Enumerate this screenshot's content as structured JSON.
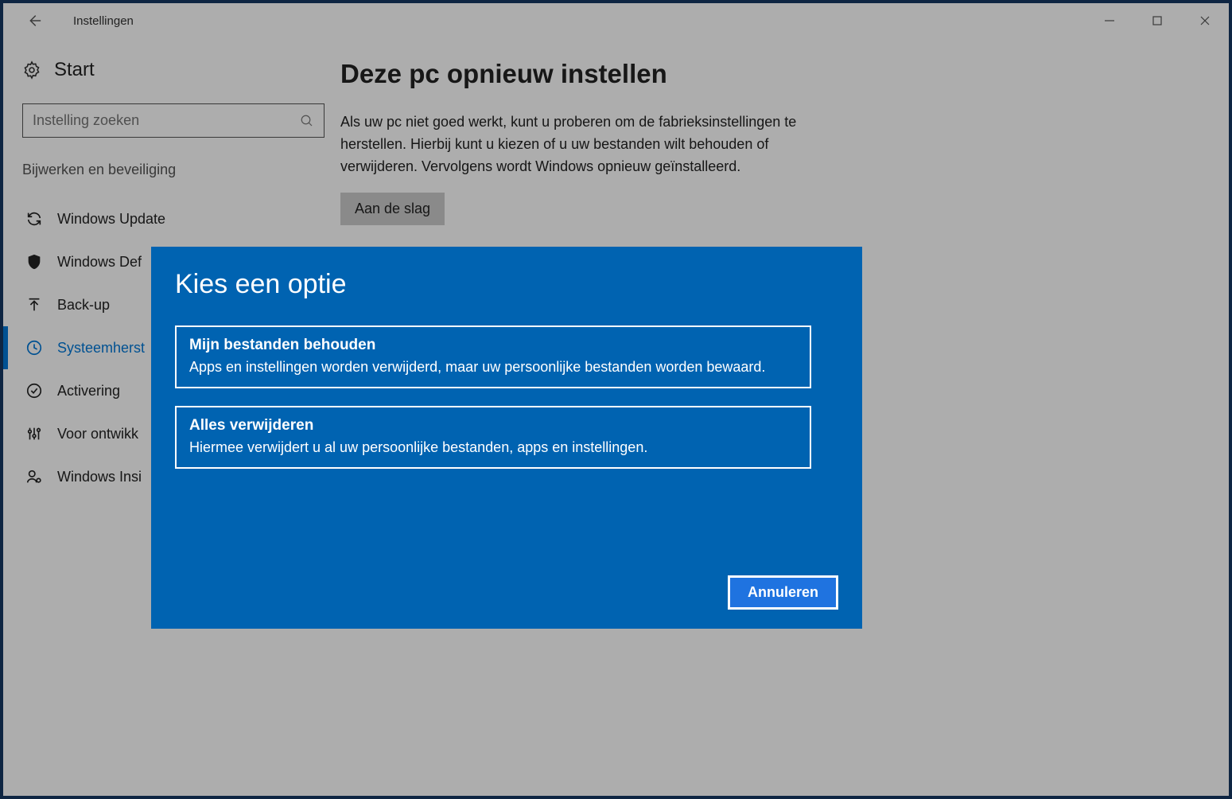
{
  "titlebar": {
    "title": "Instellingen"
  },
  "sidebar": {
    "start_label": "Start",
    "search_placeholder": "Instelling zoeken",
    "section_label": "Bijwerken en beveiliging",
    "items": [
      {
        "label": "Windows Update",
        "icon": "sync",
        "selected": false
      },
      {
        "label": "Windows Def",
        "icon": "shield",
        "selected": false
      },
      {
        "label": "Back-up",
        "icon": "backup",
        "selected": false
      },
      {
        "label": "Systeemherst",
        "icon": "history",
        "selected": true
      },
      {
        "label": "Activering",
        "icon": "check-circle",
        "selected": false
      },
      {
        "label": "Voor ontwikk",
        "icon": "developer",
        "selected": false
      },
      {
        "label": "Windows Insi",
        "icon": "insider",
        "selected": false
      }
    ]
  },
  "main": {
    "title": "Deze pc opnieuw instellen",
    "desc": "Als uw pc niet goed werkt, kunt u proberen om de fabrieksinstellingen te herstellen. Hierbij kunt u kiezen of u uw bestanden wilt behouden of verwijderen. Vervolgens wordt Windows opnieuw geïnstalleerd.",
    "cta": "Aan de slag"
  },
  "modal": {
    "title": "Kies een optie",
    "options": [
      {
        "title": "Mijn bestanden behouden",
        "desc": "Apps en instellingen worden verwijderd, maar uw persoonlijke bestanden worden bewaard."
      },
      {
        "title": "Alles verwijderen",
        "desc": "Hiermee verwijdert u al uw persoonlijke bestanden, apps en instellingen."
      }
    ],
    "cancel": "Annuleren"
  }
}
